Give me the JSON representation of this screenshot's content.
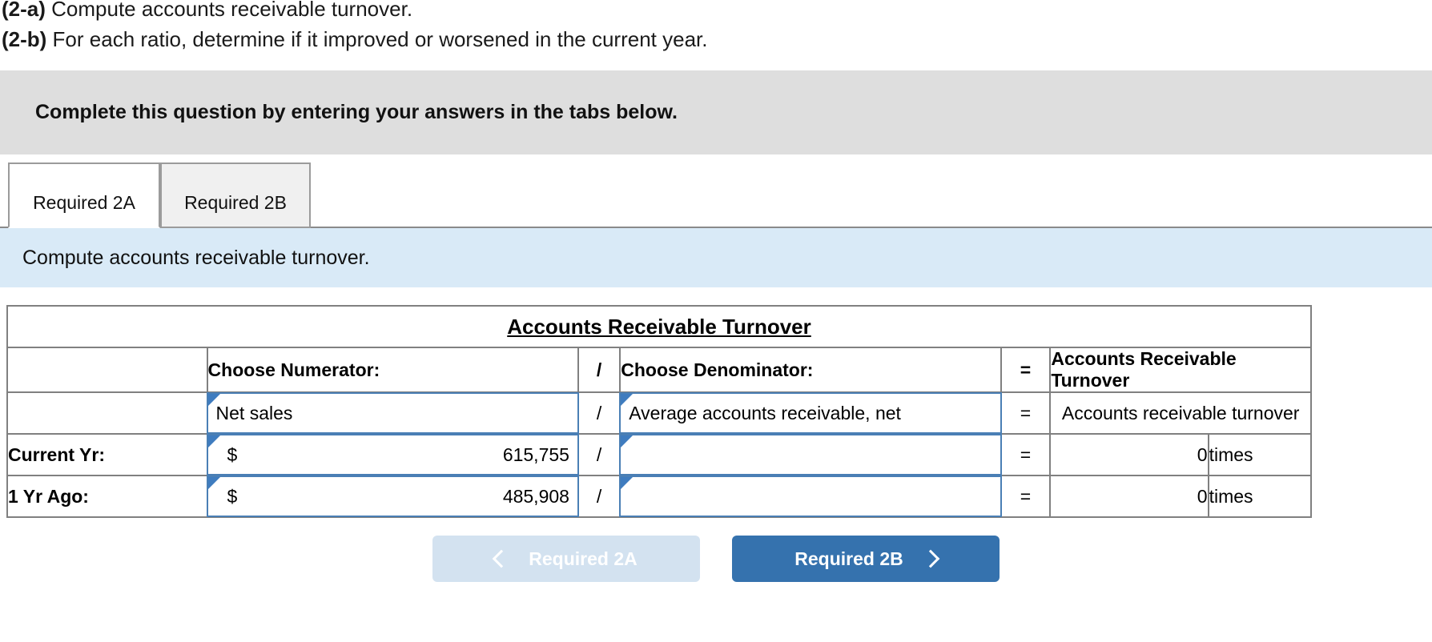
{
  "prompt": {
    "line1_label": "(2-a)",
    "line1_text": " Compute accounts receivable turnover.",
    "line2_label": "(2-b)",
    "line2_text": " For each ratio, determine if it improved or worsened in the current year."
  },
  "banner": {
    "text": "Complete this question by entering your answers in the tabs below."
  },
  "tabs": {
    "items": [
      {
        "label": "Required 2A",
        "active": true
      },
      {
        "label": "Required 2B",
        "active": false
      }
    ]
  },
  "sub_instruction": {
    "text": "Compute accounts receivable turnover."
  },
  "table": {
    "title": "Accounts Receivable Turnover",
    "headers": {
      "blank": "",
      "numerator": "Choose Numerator:",
      "divide": "/",
      "denominator": "Choose Denominator:",
      "equals": "=",
      "result": "Accounts Receivable Turnover"
    },
    "formula_row": {
      "label": "",
      "numerator": "Net sales",
      "divide": "/",
      "denominator": "Average accounts receivable, net",
      "equals": "=",
      "result": "Accounts receivable turnover"
    },
    "rows": [
      {
        "label": "Current Yr:",
        "numerator_currency": "$",
        "numerator_value": "615,755",
        "divide": "/",
        "denominator_value": "",
        "equals": "=",
        "result_value": "0",
        "units": "times"
      },
      {
        "label": "1 Yr Ago:",
        "numerator_currency": "$",
        "numerator_value": "485,908",
        "divide": "/",
        "denominator_value": "",
        "equals": "=",
        "result_value": "0",
        "units": "times"
      }
    ]
  },
  "nav": {
    "prev_label": "Required 2A",
    "next_label": "Required 2B",
    "prev_icon": "chevron-left-icon",
    "next_icon": "chevron-right-icon"
  },
  "colors": {
    "header_blue": "#7badde",
    "strip_blue": "#d9eaf7",
    "banner_grey": "#dedede",
    "button_blue": "#3572ae",
    "button_disabled": "#d3e2f0",
    "field_border": "#4a7fb5"
  }
}
